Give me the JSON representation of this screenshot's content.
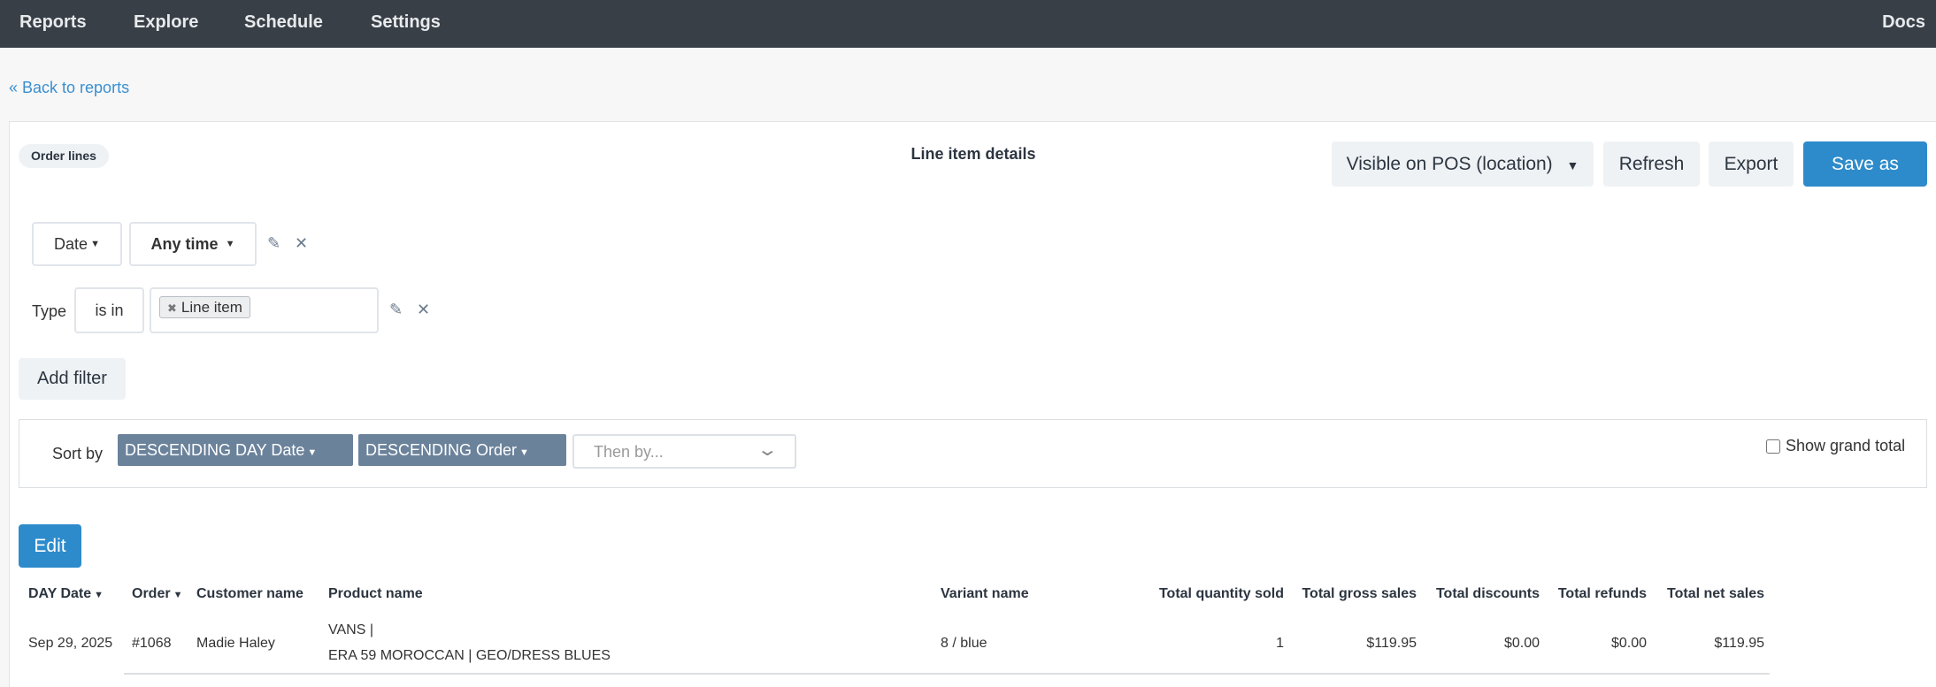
{
  "nav": {
    "items": [
      "Reports",
      "Explore",
      "Schedule",
      "Settings"
    ],
    "docs": "Docs"
  },
  "back_link": "« Back to reports",
  "report": {
    "type_pill": "Order lines",
    "title": "Line item details"
  },
  "toolbar": {
    "location_select": "Visible on POS (location)",
    "refresh": "Refresh",
    "export": "Export",
    "save_as": "Save as"
  },
  "filters": {
    "date": {
      "field": "Date",
      "value": "Any time"
    },
    "type": {
      "label": "Type",
      "operator": "is in",
      "values": [
        "Line item"
      ]
    },
    "add_filter": "Add filter"
  },
  "sort": {
    "label": "Sort by",
    "items": [
      "DESCENDING DAY Date",
      "DESCENDING Order"
    ],
    "then_by_placeholder": "Then by...",
    "show_grand_total_label": "Show grand total",
    "show_grand_total_checked": false
  },
  "edit_label": "Edit",
  "table": {
    "columns": [
      "DAY Date",
      "Order",
      "Customer name",
      "Product name",
      "Variant name",
      "Total quantity sold",
      "Total gross sales",
      "Total discounts",
      "Total refunds",
      "Total net sales"
    ],
    "rows": [
      {
        "date": "Sep 29, 2025",
        "order": "#1068",
        "customer": "Madie Haley",
        "product_line1": "VANS |",
        "product_line2": "ERA 59 MOROCCAN | GEO/DRESS BLUES",
        "variant": "8 / blue",
        "qty": "1",
        "gross": "$119.95",
        "discounts": "$0.00",
        "refunds": "$0.00",
        "net": "$119.95"
      }
    ]
  },
  "colors": {
    "nav_bg": "#383f47",
    "primary": "#2e8bcb",
    "sort_chip": "#6b829b",
    "link": "#3a8fd0"
  }
}
